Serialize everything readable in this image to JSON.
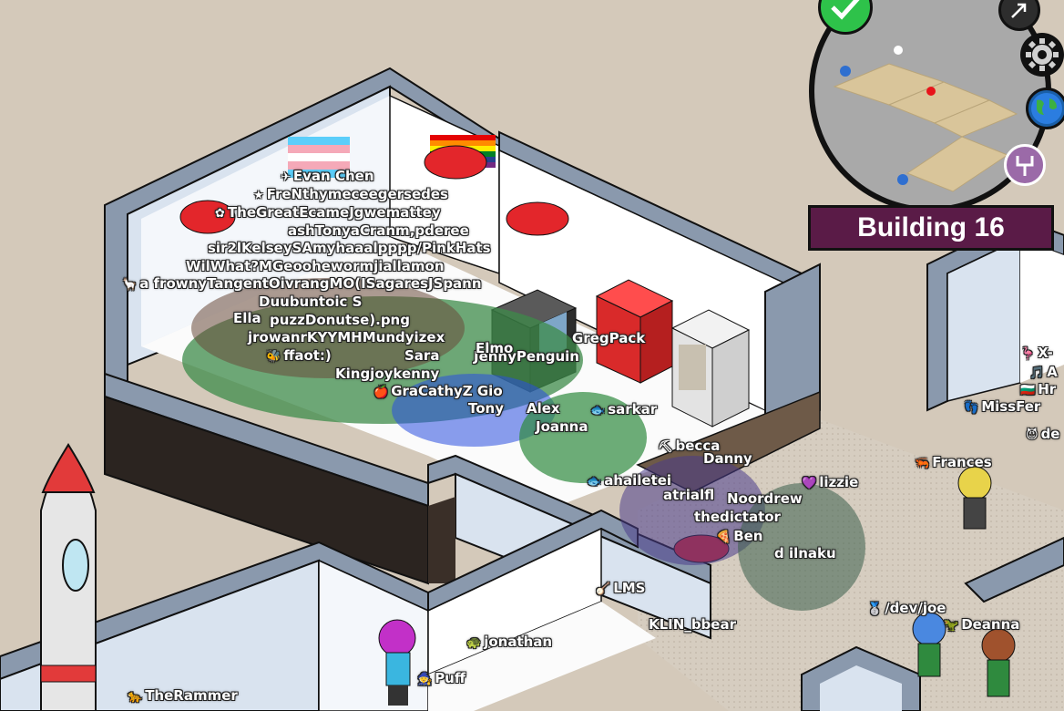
{
  "minimap": {
    "building_label": "Building 16",
    "buttons": [
      {
        "name": "confirm-button",
        "icon": "check-icon",
        "color": "#2ec24a"
      },
      {
        "name": "teleport-button",
        "icon": "arrow-icon"
      },
      {
        "name": "settings-button",
        "icon": "gear-icon"
      },
      {
        "name": "world-button",
        "icon": "globe-icon"
      },
      {
        "name": "building-button",
        "icon": "tools-icon",
        "color": "#9b6aa8"
      }
    ]
  },
  "colors": {
    "floor": "#d4c9ba",
    "wall_face": "#d9e3ef",
    "wall_top": "#8a99ad",
    "room_floor": "#ffffff",
    "label_bg": "#5a1b47"
  },
  "names": {
    "crowd": [
      "Evan Chen",
      "FreNthymeceegersedes",
      "TheGreatEcameJgwemattey",
      "ashTonyaCranm,pderee",
      "sir2lKelseySAmyhaaalpppp/PinkHats",
      "WilWhat?MGeoohewormjiallamon",
      "a frownyTangentOivrangMO(ISagaresJSpann",
      "Duubuntoic S",
      "Ella",
      "puzzDonutse).png",
      "jrowanrKYYMHMundyizex",
      "ffaot:)",
      "Sara",
      "Kingjoykenny",
      "GraCathyZ Gio",
      "Tony",
      "Alex",
      "Joanna",
      "GregPack",
      "JennyPenguin",
      "Elmo",
      "sarkar"
    ],
    "hall": [
      "becca",
      "Danny",
      "ahailetei",
      "atrialfl",
      "Noordrew",
      "thedictator",
      "Ben",
      "lizzie",
      "d ilnaku",
      "Frances",
      "MissFer",
      "X-",
      "A",
      "Hr",
      "de",
      "LMS",
      "KLIN_bbear",
      "/dev/joe",
      "Deanna",
      "jonathan",
      "Puff",
      "TheRammer"
    ]
  }
}
